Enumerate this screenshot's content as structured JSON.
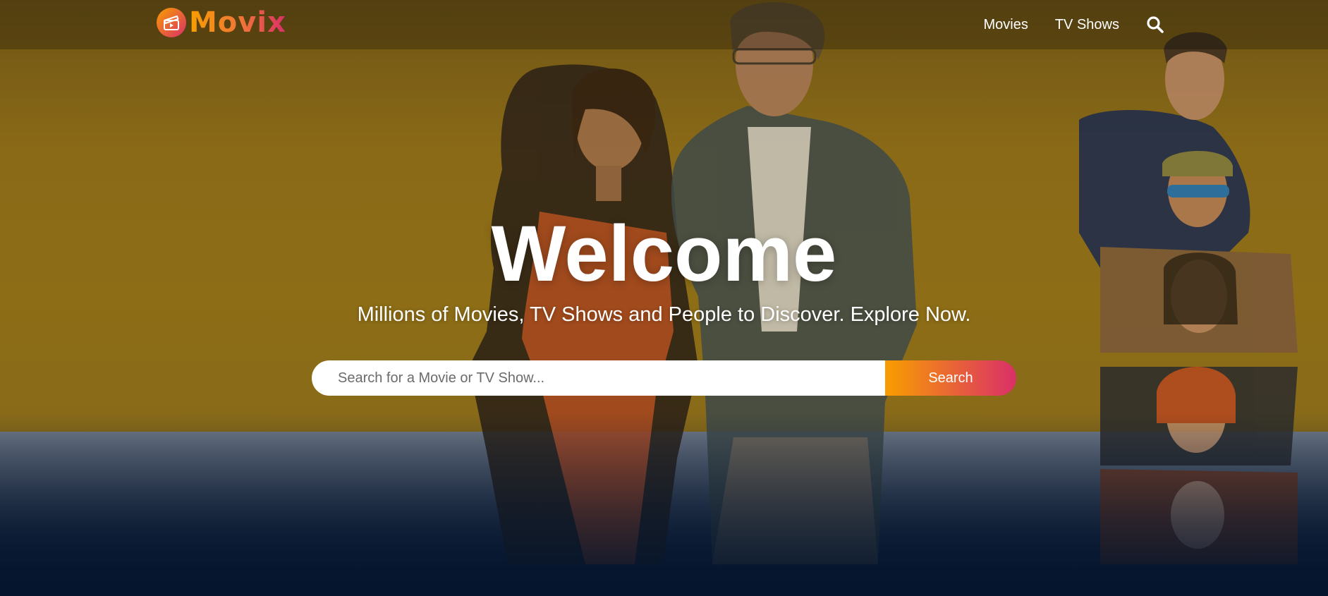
{
  "colors": {
    "brand_gradient_start": "#f89e00",
    "brand_gradient_end": "#da2f68",
    "background_dark": "#04152d",
    "hero_tint": "#8a6a17"
  },
  "header": {
    "logo": {
      "icon": "film-clapper-icon",
      "text": "Movix"
    },
    "nav": {
      "items": [
        {
          "label": "Movies"
        },
        {
          "label": "TV Shows"
        }
      ],
      "search_icon": "search-icon"
    }
  },
  "hero": {
    "title": "Welcome",
    "subtitle": "Millions of Movies, TV Shows and People to Discover. Explore Now.",
    "search": {
      "placeholder": "Search for a Movie or TV Show...",
      "value": "",
      "button_label": "Search"
    },
    "backdrop_image": "movie-poster-backdrop"
  }
}
